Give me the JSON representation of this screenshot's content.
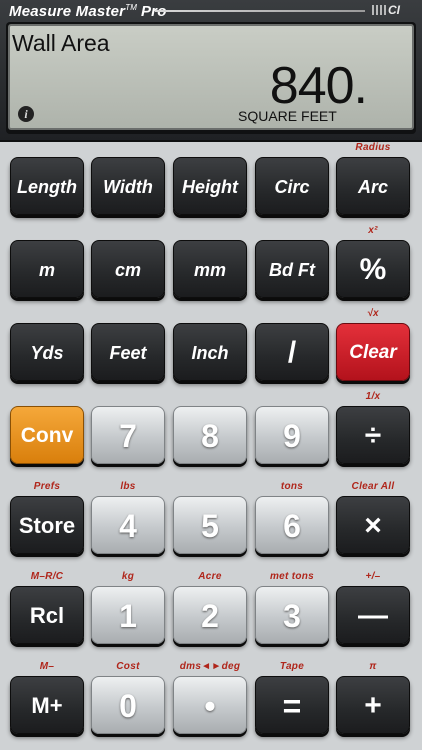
{
  "brand": {
    "name_a": "Measure Master",
    "tm": "TM",
    "name_b": "Pro",
    "logo_text": "CI"
  },
  "display": {
    "label": "Wall Area",
    "value": "840.",
    "unit": "SQUARE FEET"
  },
  "keys": {
    "row1": [
      "Length",
      "Width",
      "Height",
      "Circ",
      "Arc"
    ],
    "row2": [
      "m",
      "cm",
      "mm",
      "Bd Ft",
      "%"
    ],
    "row3": [
      "Yds",
      "Feet",
      "Inch",
      "/",
      "Clear"
    ],
    "row4": [
      "Conv",
      "7",
      "8",
      "9",
      "÷"
    ],
    "row5": [
      "Store",
      "4",
      "5",
      "6",
      "×"
    ],
    "row6": [
      "Rcl",
      "1",
      "2",
      "3",
      "—"
    ],
    "row7": [
      "M+",
      "0",
      "•",
      "=",
      "+"
    ]
  },
  "second_labels": {
    "row1": [
      "",
      "",
      "",
      "",
      "Radius"
    ],
    "row2": [
      "",
      "",
      "",
      "",
      "x²"
    ],
    "row3": [
      "",
      "",
      "",
      "",
      "√x"
    ],
    "row4": [
      "",
      "",
      "",
      "",
      "1/x"
    ],
    "row5": [
      "Prefs",
      "lbs",
      "",
      "tons",
      "Clear All"
    ],
    "row6": [
      "M–R/C",
      "kg",
      "Acre",
      "met tons",
      "+/–"
    ],
    "row7": [
      "M–",
      "Cost",
      "dms◄►deg",
      "Tape",
      "π"
    ]
  },
  "colors": {
    "accent_red": "#c81e27",
    "accent_orange": "#f29a28",
    "label_red": "#b0261b",
    "lcd": "#bfc3bb"
  }
}
